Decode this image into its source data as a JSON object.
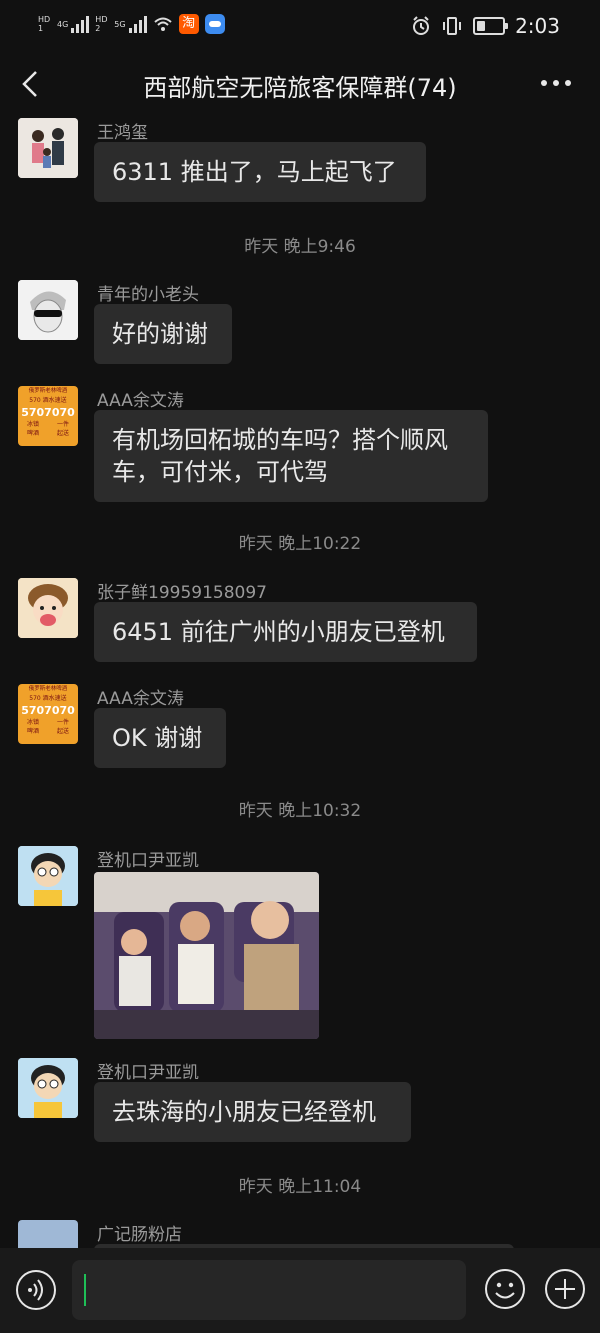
{
  "status_bar": {
    "hd1": "HD 1",
    "net1": "4G",
    "hd2": "HD 2",
    "net2": "5G",
    "taobao_icon_text": "淘",
    "time": "2:03"
  },
  "header": {
    "title": "西部航空无陪旅客保障群(74)"
  },
  "messages": [
    {
      "sender": "王鸿玺",
      "text": "6311 推出了，马上起飞了"
    },
    {
      "sender": "青年的小老头",
      "text": "好的谢谢"
    },
    {
      "sender": "AAA余文涛",
      "text": "有机场回柘城的车吗？搭个顺风车，可付米，可代驾"
    },
    {
      "sender": "张子鲜19959158097",
      "text": "6451 前往广州的小朋友已登机"
    },
    {
      "sender": "AAA余文涛",
      "text": "OK 谢谢"
    },
    {
      "sender": "登机口尹亚凯",
      "text": ""
    },
    {
      "sender": "登机口尹亚凯",
      "text": "去珠海的小朋友已经登机"
    },
    {
      "sender": "广记肠粉店",
      "text": ""
    }
  ],
  "timestamps": [
    "昨天 晚上9:46",
    "昨天 晚上10:22",
    "昨天 晚上10:32",
    "昨天 晚上11:04"
  ],
  "avatar_ad": {
    "line1": "俄罗斯老林啤酒",
    "line2a": "570",
    "line2b": "酒水速送",
    "phone": "5707070",
    "line4a": "冰镇",
    "line4b": "一件",
    "line5a": "啤酒",
    "line5b": "起送"
  },
  "input": {
    "value": ""
  },
  "colors": {
    "background": "#111111",
    "bubble": "#2c2c2c",
    "cursor": "#1fbf57",
    "ad_avatar": "#f0a12a"
  }
}
